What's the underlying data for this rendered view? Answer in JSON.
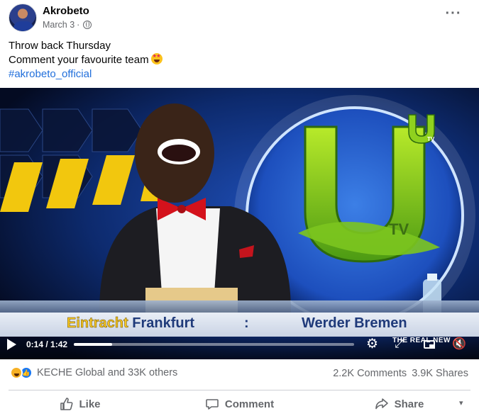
{
  "post": {
    "author": "Akrobeto",
    "date": "March 3",
    "date_separator": "·",
    "text_lines": [
      "Throw back Thursday",
      "Comment your favourite team"
    ],
    "hashtag": "#akrobeto_official",
    "more_label": "···"
  },
  "video": {
    "channel_logo_text": "TV",
    "ticker": {
      "home_first": "Eintracht",
      "home_second": "Frankfurt",
      "separator": ":",
      "away": "Werder Bremen",
      "right_label": "THE REAL NEW"
    },
    "controls": {
      "time": "0:14 / 1:42",
      "progress_fraction": 0.136
    }
  },
  "engagement": {
    "reactors": "KECHE Global and 33K others",
    "comments": "2.2K Comments",
    "shares": "3.9K Shares"
  },
  "actions": {
    "like": "Like",
    "comment": "Comment",
    "share": "Share"
  },
  "colors": {
    "link": "#216fdb",
    "secondary_text": "#65676b",
    "like_blue": "#1877f2"
  }
}
